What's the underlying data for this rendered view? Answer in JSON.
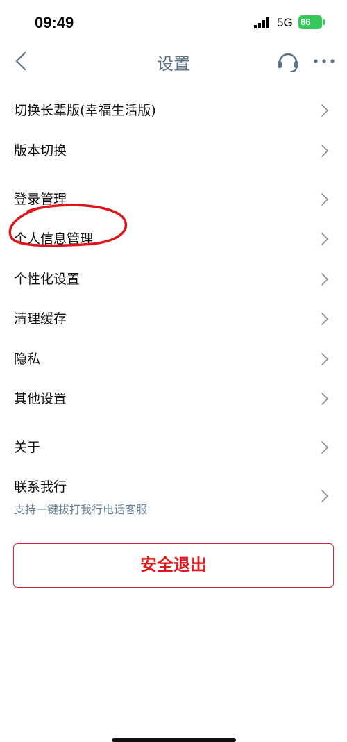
{
  "status_bar": {
    "time": "09:49",
    "network": "5G",
    "battery": "86"
  },
  "nav": {
    "title": "设置",
    "back_icon": "chevron-left-icon",
    "support_icon": "headset-icon",
    "more_icon": "more-dots-icon"
  },
  "settings": {
    "items": [
      {
        "label": "切换长辈版(幸福生活版)"
      },
      {
        "label": "版本切换"
      },
      {
        "label": "登录管理"
      },
      {
        "label": "个人信息管理"
      },
      {
        "label": "个性化设置"
      },
      {
        "label": "清理缓存"
      },
      {
        "label": "隐私"
      },
      {
        "label": "其他设置"
      },
      {
        "label": "关于"
      },
      {
        "label": "联系我行",
        "subtitle": "支持一键拔打我行电话客服"
      }
    ]
  },
  "logout": {
    "label": "安全退出"
  },
  "colors": {
    "accent": "#5a7187",
    "danger": "#e1181c",
    "battery": "#35c759",
    "annotation": "#e01418"
  }
}
